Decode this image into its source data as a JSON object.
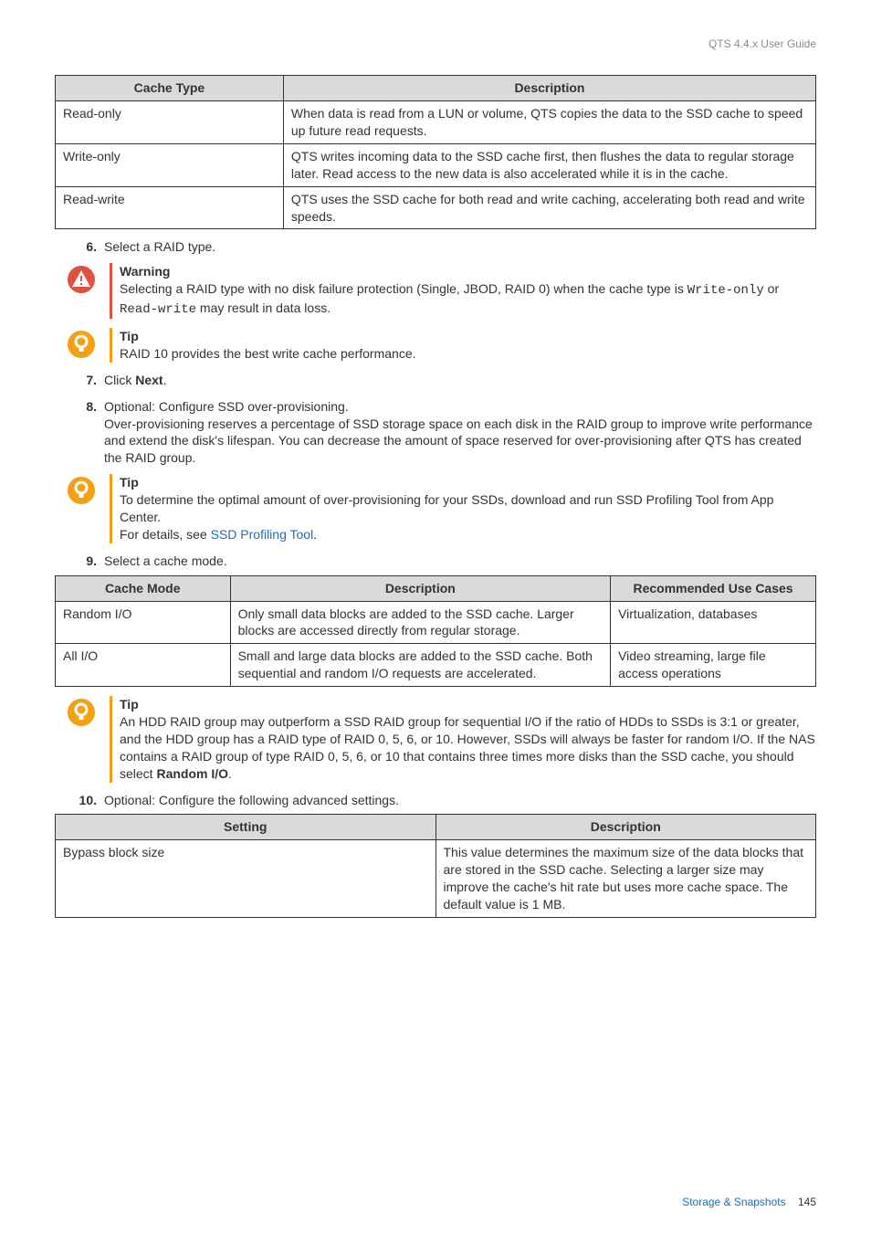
{
  "header": {
    "doc_title": "QTS 4.4.x User Guide"
  },
  "table_cache_type": {
    "head": {
      "c1": "Cache Type",
      "c2": "Description"
    },
    "rows": [
      {
        "c1": "Read-only",
        "c2": "When data is read from a LUN or volume, QTS copies the data to the SSD cache to speed up future read requests."
      },
      {
        "c1": "Write-only",
        "c2": "QTS writes incoming data to the SSD cache first, then flushes the data to regular storage later. Read access to the new data is also accelerated while it is in the cache."
      },
      {
        "c1": "Read-write",
        "c2": "QTS uses the SSD cache for both read and write caching, accelerating both read and write speeds."
      }
    ]
  },
  "step6": {
    "num": "6.",
    "text": "Select a RAID type."
  },
  "warning1": {
    "title": "Warning",
    "line1_a": "Selecting a RAID type with no disk failure protection (Single, JBOD, RAID 0) when the cache type is ",
    "code1": "Write-only",
    "sep": " or ",
    "code2": "Read-write",
    "line1_b": " may result in data loss."
  },
  "tip1": {
    "title": "Tip",
    "text": "RAID 10 provides the best write cache performance."
  },
  "step7": {
    "num": "7.",
    "pre": "Click ",
    "bold": "Next",
    "post": "."
  },
  "step8": {
    "num": "8.",
    "line1": "Optional: Configure SSD over-provisioning.",
    "line2": "Over-provisioning reserves a percentage of SSD storage space on each disk in the RAID group to improve write performance and extend the disk's lifespan. You can decrease the amount of space reserved for over-provisioning after QTS has created the RAID group."
  },
  "tip2": {
    "title": "Tip",
    "line1": "To determine the optimal amount of over-provisioning for your SSDs, download and run SSD Profiling Tool from App Center.",
    "line2_pre": "For details, see ",
    "link": "SSD Profiling Tool",
    "line2_post": "."
  },
  "step9": {
    "num": "9.",
    "text": "Select a cache mode."
  },
  "table_cache_mode": {
    "head": {
      "c1": "Cache Mode",
      "c2": "Description",
      "c3": "Recommended Use Cases"
    },
    "rows": [
      {
        "c1": "Random I/O",
        "c2": "Only small data blocks are added to the SSD cache. Larger blocks are accessed directly from regular storage.",
        "c3": "Virtualization, databases"
      },
      {
        "c1": "All I/O",
        "c2": "Small and large data blocks are added to the SSD cache. Both sequential and random I/O requests are accelerated.",
        "c3": "Video streaming, large file access operations"
      }
    ]
  },
  "tip3": {
    "title": "Tip",
    "text_a": "An HDD RAID group may outperform a SSD RAID group for sequential I/O if the ratio of HDDs to SSDs is 3:1 or greater, and the HDD group has a RAID type of RAID 0, 5, 6, or 10. However, SSDs will always be faster for random I/O. If the NAS contains a RAID group of type RAID 0, 5, 6, or 10 that contains three times more disks than the SSD cache, you should select ",
    "bold": "Random I/O",
    "text_b": "."
  },
  "step10": {
    "num": "10.",
    "text": "Optional: Configure the following advanced settings."
  },
  "table_settings": {
    "head": {
      "c1": "Setting",
      "c2": "Description"
    },
    "rows": [
      {
        "c1": "Bypass block size",
        "c2": "This value determines the maximum size of the data blocks that are stored in the SSD cache. Selecting a larger size may improve the cache's hit rate but uses more cache space. The default value is 1 MB."
      }
    ]
  },
  "footer": {
    "section": "Storage & Snapshots",
    "page": "145"
  }
}
